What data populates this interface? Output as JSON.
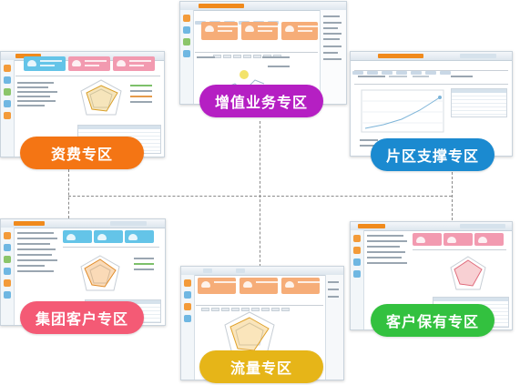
{
  "zones": [
    {
      "label": "资费专区",
      "color": "#f47514"
    },
    {
      "label": "增值业务专区",
      "color": "#b51fc3"
    },
    {
      "label": "片区支撑专区",
      "color": "#1b8ad0"
    },
    {
      "label": "集团客户专区",
      "color": "#f45a75"
    },
    {
      "label": "流量专区",
      "color": "#e6b518"
    },
    {
      "label": "客户保有专区",
      "color": "#33c13f"
    }
  ]
}
